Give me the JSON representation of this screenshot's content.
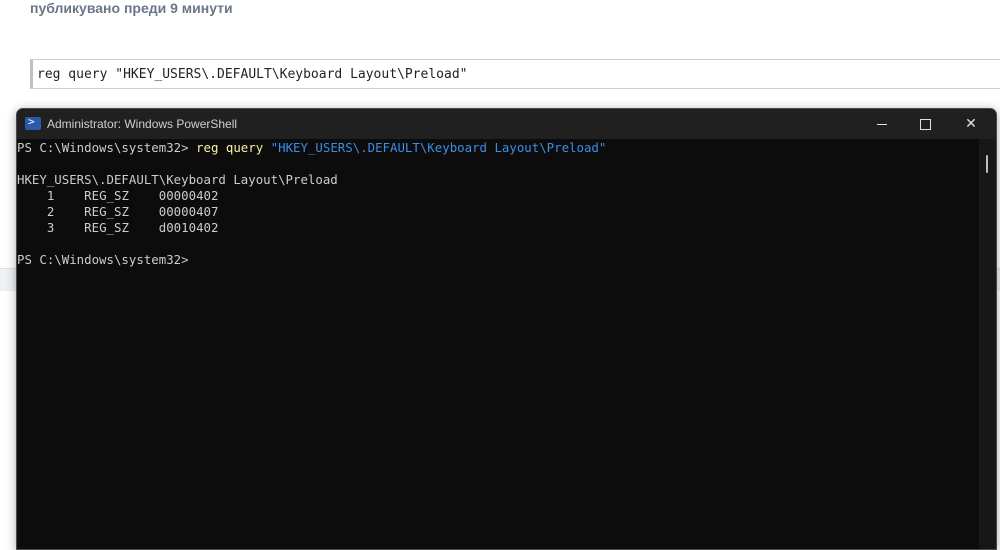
{
  "page": {
    "meta_text": "публикувано преди 9 минути",
    "code_snippet": "reg query \"HKEY_USERS\\.DEFAULT\\Keyboard Layout\\Preload\""
  },
  "window": {
    "title": "Administrator: Windows PowerShell",
    "icon": "powershell-icon",
    "controls": {
      "minimize": "minimize-icon",
      "maximize": "maximize-icon",
      "close": "✕"
    }
  },
  "console": {
    "prompt1": "PS C:\\Windows\\system32> ",
    "cmd_name": "reg query ",
    "cmd_arg": "\"HKEY_USERS\\.DEFAULT\\Keyboard Layout\\Preload\"",
    "key_path": "HKEY_USERS\\.DEFAULT\\Keyboard Layout\\Preload",
    "entries": [
      {
        "name": "1",
        "type": "REG_SZ",
        "value": "00000402"
      },
      {
        "name": "2",
        "type": "REG_SZ",
        "value": "00000407"
      },
      {
        "name": "3",
        "type": "REG_SZ",
        "value": "d0010402"
      }
    ],
    "prompt2": "PS C:\\Windows\\system32>"
  },
  "colors": {
    "console_bg": "#0c0c0c",
    "console_text": "#cccccc",
    "command_color": "#f9f1a5",
    "string_color": "#3b8eea"
  }
}
